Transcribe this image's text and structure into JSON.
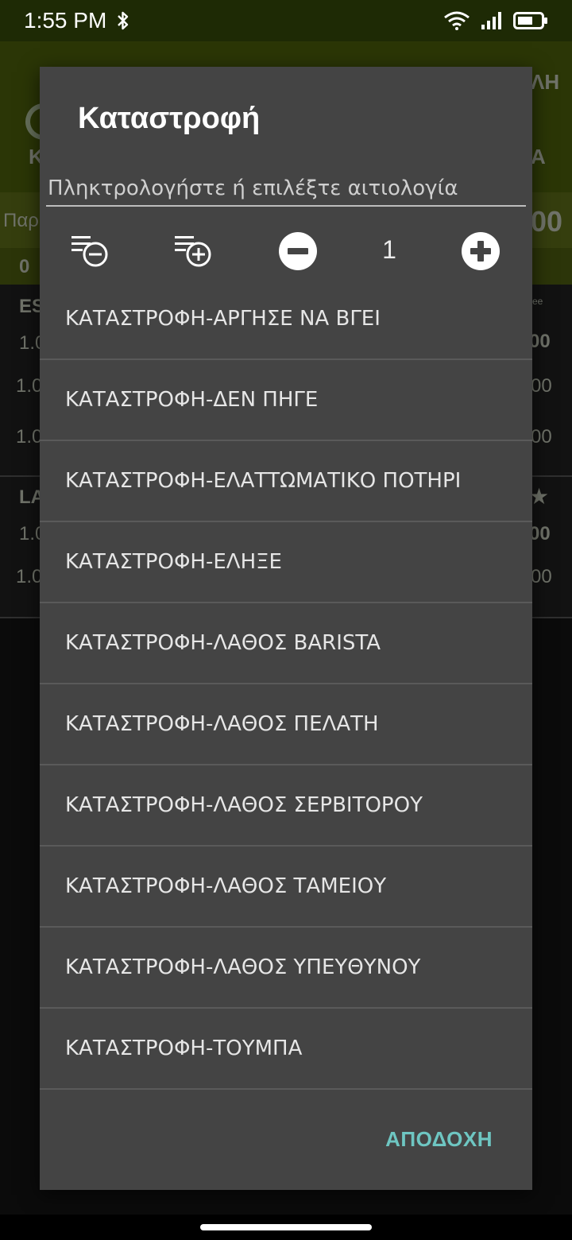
{
  "status_bar": {
    "time": "1:55 PM"
  },
  "background": {
    "appbar_right": "ΛΗ",
    "tab_left": "Κ",
    "tab_right": "Α",
    "field_left": "Παρ",
    "field_right": "00",
    "strip_left": "0",
    "row_labels": [
      "ES",
      "1.0",
      "1.0",
      "1.0",
      "LA",
      "1.0",
      "1.0"
    ],
    "row_values": [
      "00",
      "00",
      "00",
      "00",
      "00"
    ],
    "badge_text": "ree"
  },
  "dialog": {
    "title": "Καταστροφή",
    "search_placeholder": "Πληκτρολογήστε ή επιλέξτε αιτιολογία",
    "quantity": "1",
    "icons": [
      "playlist-remove-icon",
      "playlist-add-icon",
      "minus-circle-icon",
      "plus-circle-icon"
    ],
    "reasons": [
      "ΚΑΤΑΣΤΡΟΦΗ-ΑΡΓΗΣΕ ΝΑ ΒΓΕΙ",
      "ΚΑΤΑΣΤΡΟΦΗ-ΔΕΝ ΠΗΓΕ",
      "ΚΑΤΑΣΤΡΟΦΗ-ΕΛΑΤΤΩΜΑΤΙΚΟ ΠΟΤΗΡΙ",
      "ΚΑΤΑΣΤΡΟΦΗ-ΕΛΗΞΕ",
      "ΚΑΤΑΣΤΡΟΦΗ-ΛΑΘΟΣ BARISTA",
      "ΚΑΤΑΣΤΡΟΦΗ-ΛΑΘΟΣ ΠΕΛΑΤΗ",
      "ΚΑΤΑΣΤΡΟΦΗ-ΛΑΘΟΣ ΣΕΡΒΙΤΟΡΟΥ",
      "ΚΑΤΑΣΤΡΟΦΗ-ΛΑΘΟΣ ΤΑΜΕΙΟΥ",
      "ΚΑΤΑΣΤΡΟΦΗ-ΛΑΘΟΣ ΥΠΕΥΘΥΝΟΥ",
      "ΚΑΤΑΣΤΡΟΦΗ-ΤΟΥΜΠΑ"
    ],
    "accept_label": "ΑΠΟΔΟΧΗ"
  },
  "colors": {
    "dialog_bg": "#444444",
    "accent": "#6ec6c2",
    "appbar_bg": "#2f3b07"
  }
}
